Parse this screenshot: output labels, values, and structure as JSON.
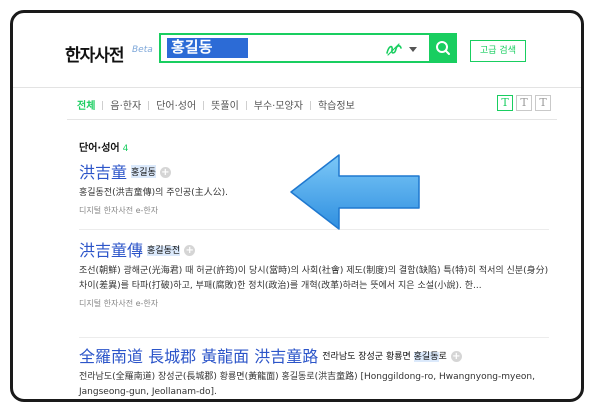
{
  "header": {
    "logo": "한자사전",
    "logo_badge": "Beta",
    "search_value": "홍길동",
    "advanced_search_label": "고급 검색"
  },
  "tabs": {
    "items": [
      "전체",
      "음·한자",
      "단어·성어",
      "뜻풀이",
      "부수·모양자",
      "학습정보"
    ],
    "active_index": 0,
    "font_options": [
      "T",
      "T",
      "T"
    ]
  },
  "section": {
    "title": "단어·성어",
    "count": "4"
  },
  "entries": [
    {
      "hanja": "洪吉童",
      "reading": "홍길동",
      "desc": "홍길동전(洪吉童傳)의 주인공(主人公).",
      "source": "디지털 한자사전 e-한자"
    },
    {
      "hanja": "洪吉童傳",
      "reading": "홍길동전",
      "desc": "조선(朝鮮) 광해군(光海君) 때 허균(許筠)이 당시(當時)의 사회(社會) 제도(制度)의 결함(缺陷) 특(特)히 적서의 신분(身分) 차이(差異)를 타파(打破)하고, 부패(腐敗)한 정치(政治)를 개혁(改革)하려는 뜻에서 지은 소설(小說). 한...",
      "source": "디지털 한자사전 e-한자"
    },
    {
      "hanja": "全羅南道 長城郡 黃龍面 洪吉童路",
      "reading_pre": "전라남도 장성군 황룡면 ",
      "reading_hl": "홍길동",
      "reading_post": "로",
      "desc": "전라남도(全羅南道) 장성군(長城郡) 황룡면(黃龍面) 홍길동로(洪吉童路) [Honggildong-ro, Hwangnyong-myeon, Jangseong-gun, Jeollanam-do]."
    }
  ]
}
